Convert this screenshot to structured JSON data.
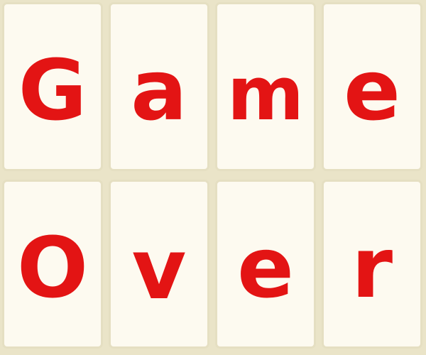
{
  "tiles": [
    {
      "letter": "G"
    },
    {
      "letter": "a"
    },
    {
      "letter": "m"
    },
    {
      "letter": "e"
    },
    {
      "letter": "O"
    },
    {
      "letter": "v"
    },
    {
      "letter": "e"
    },
    {
      "letter": "r"
    }
  ],
  "colors": {
    "background": "#eae4c8",
    "tile_face": "#fdfaf0",
    "tile_border": "#e5dfc2",
    "letter": "#e31414"
  }
}
